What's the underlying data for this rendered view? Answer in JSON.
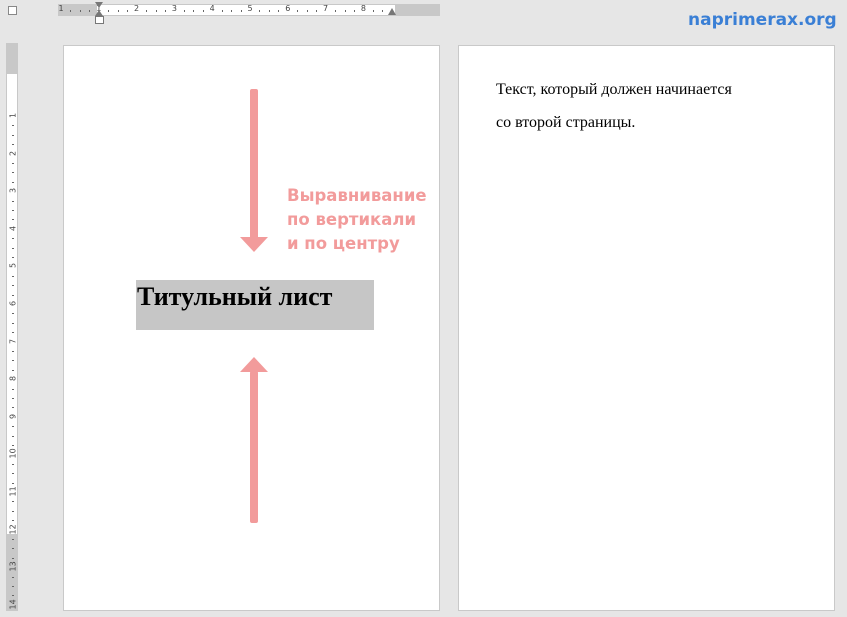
{
  "watermark": "naprimerax.org",
  "ruler_h": {
    "numbers": [
      "1",
      "1",
      "2",
      "3",
      "4",
      "5",
      "6",
      "7",
      "8"
    ]
  },
  "ruler_v": {
    "numbers": [
      "1",
      "2",
      "3",
      "4",
      "5",
      "6",
      "7",
      "8",
      "9",
      "10",
      "11",
      "12",
      "13",
      "14"
    ]
  },
  "page1": {
    "title": "Титульный лист",
    "annotation": [
      "Выравнивание",
      "по вертикали",
      "и по центру"
    ],
    "annotation_color": "#f29b9b"
  },
  "page2": {
    "lines": [
      "Текст, который должен начинается",
      "со второй страницы."
    ]
  },
  "colors": {
    "arrow": "#f29b9b",
    "highlight": "#c6c6c6",
    "watermark": "#3a7fd5"
  }
}
